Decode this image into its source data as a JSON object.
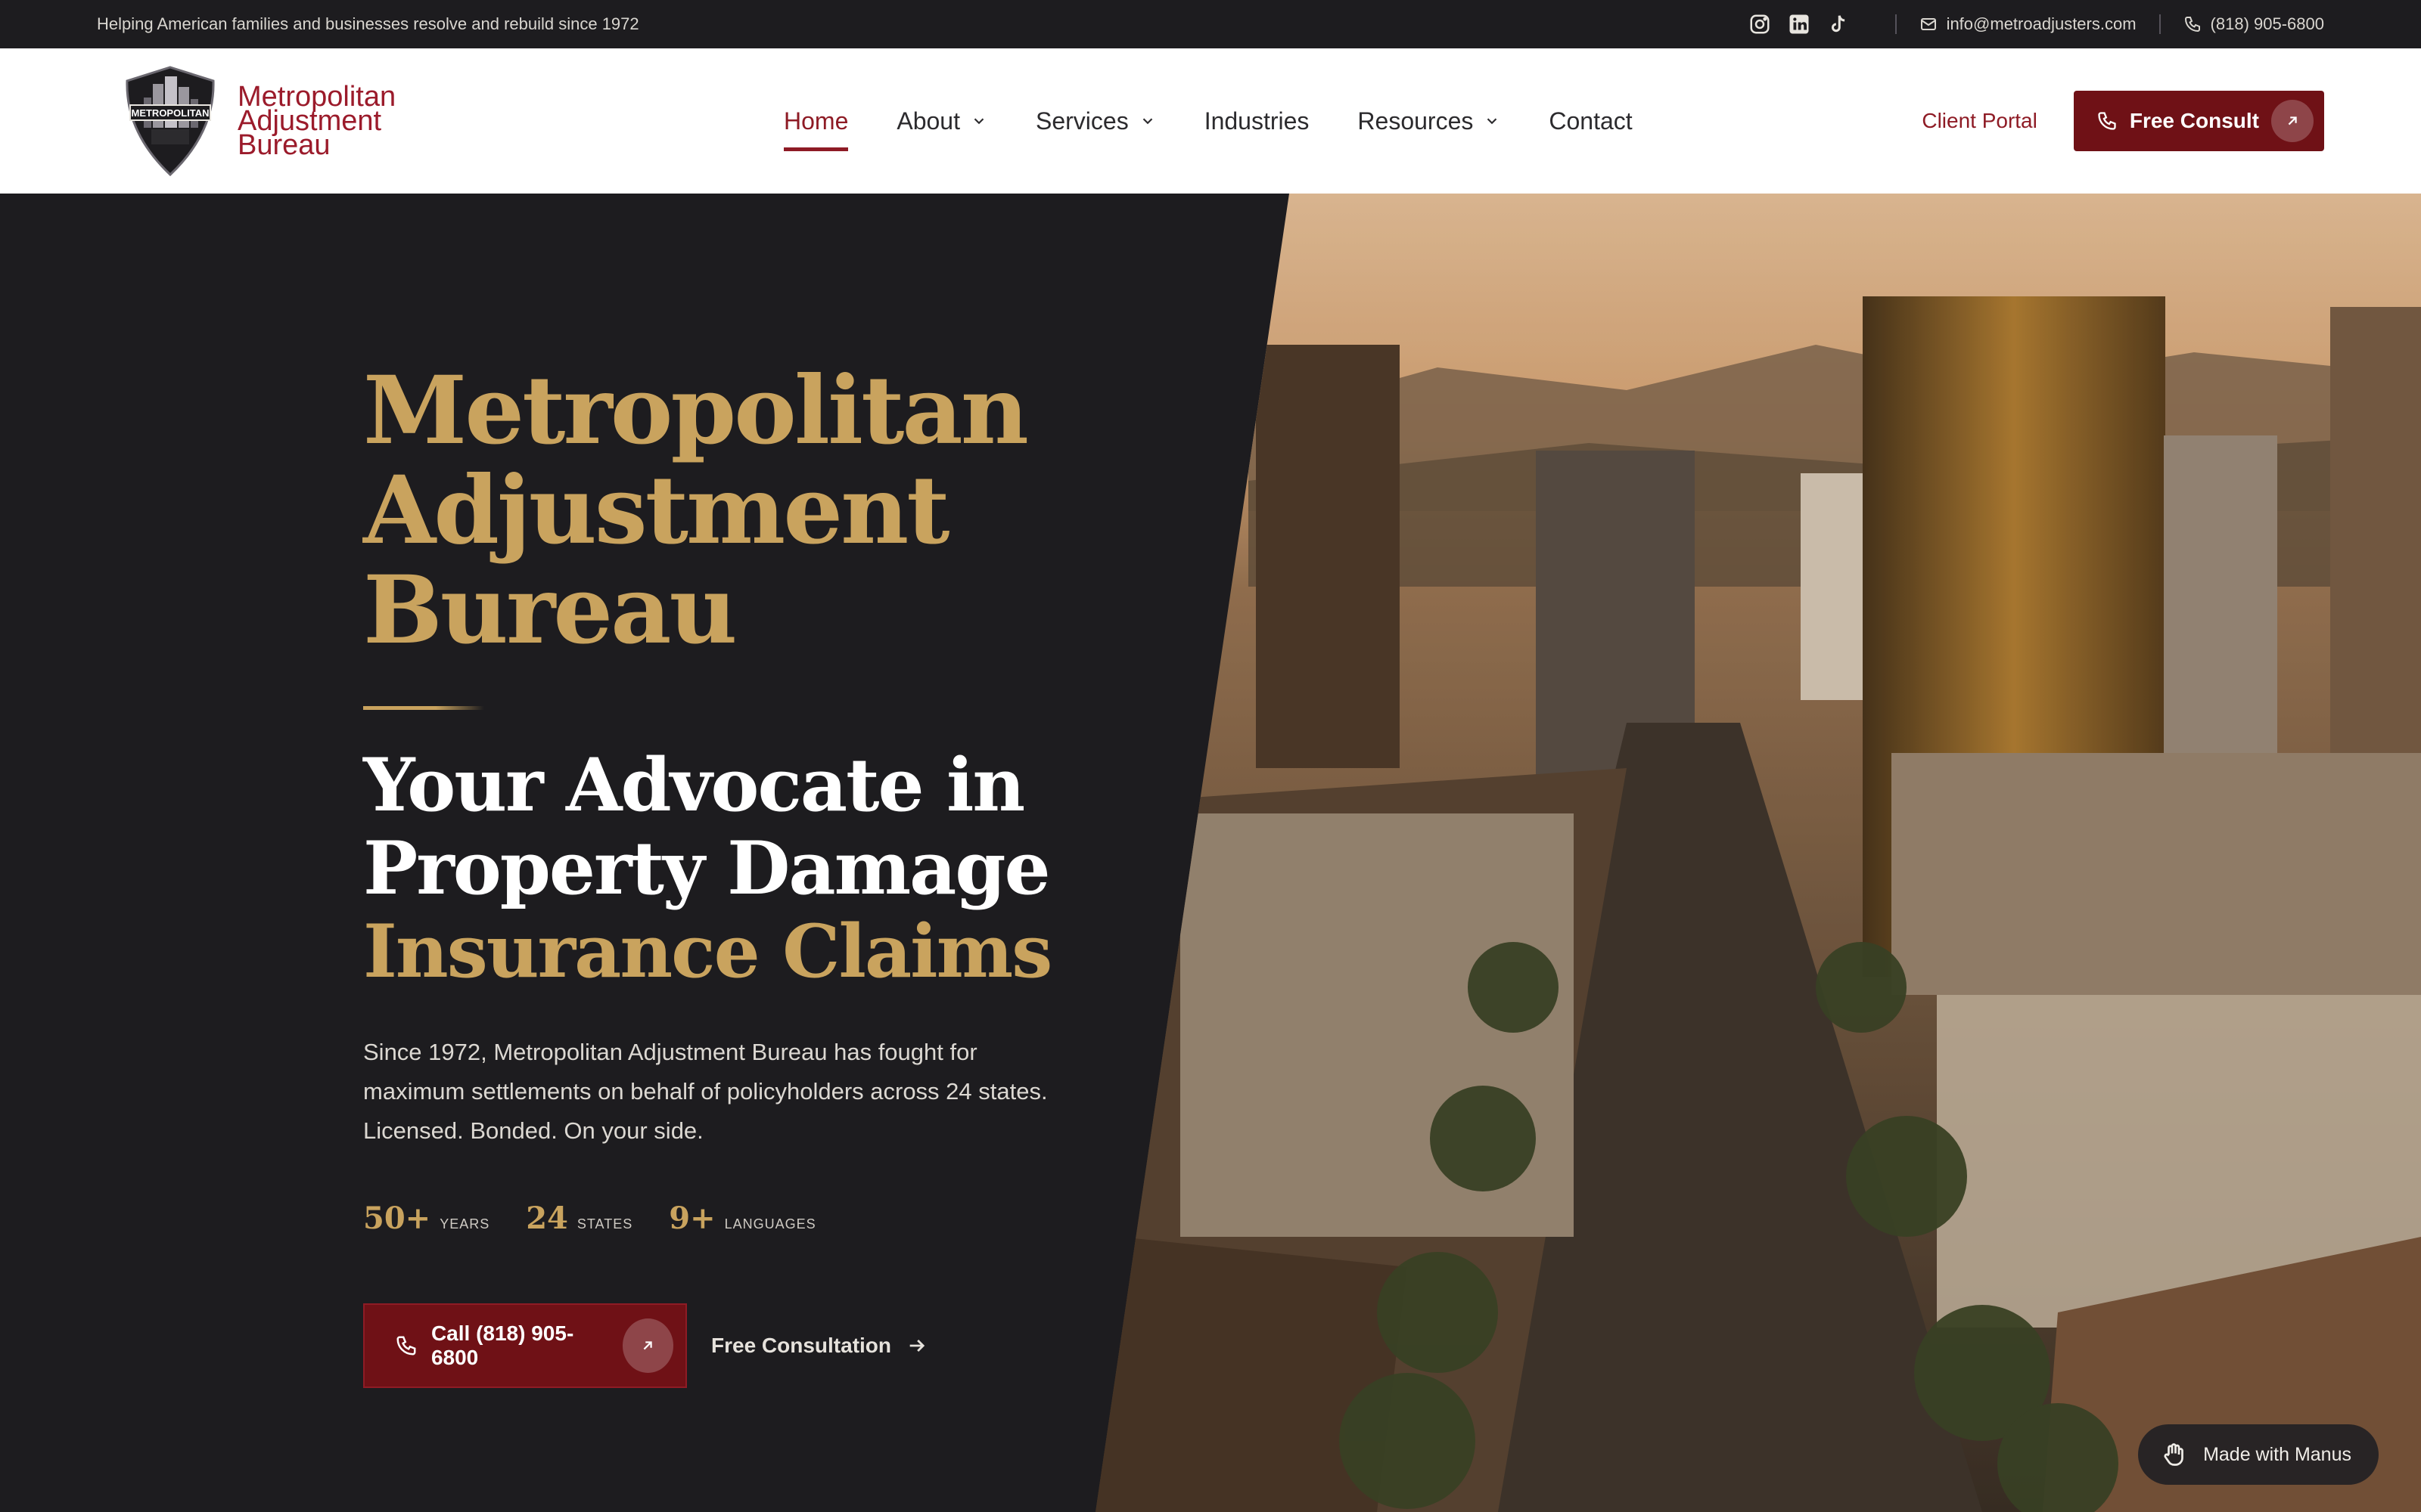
{
  "topbar": {
    "tagline": "Helping American families and businesses resolve and rebuild since 1972",
    "social": [
      "instagram-icon",
      "linkedin-icon",
      "tiktok-icon"
    ],
    "email": "info@metroadjusters.com",
    "phone": "(818) 905-6800"
  },
  "logo": {
    "badge_text": "METROPOLITAN",
    "line1": "Metropolitan",
    "line2": "Adjustment",
    "line3": "Bureau"
  },
  "nav": {
    "items": [
      {
        "label": "Home",
        "active": true,
        "dropdown": false
      },
      {
        "label": "About",
        "active": false,
        "dropdown": true
      },
      {
        "label": "Services",
        "active": false,
        "dropdown": true
      },
      {
        "label": "Industries",
        "active": false,
        "dropdown": false
      },
      {
        "label": "Resources",
        "active": false,
        "dropdown": true
      },
      {
        "label": "Contact",
        "active": false,
        "dropdown": false
      }
    ],
    "portal_label": "Client Portal",
    "consult_label": "Free Consult"
  },
  "hero": {
    "title_line1": "Metropolitan",
    "title_line2": "Adjustment",
    "title_line3": "Bureau",
    "sub_line1": "Your Advocate in",
    "sub_line2": "Property Damage",
    "sub_line3": "Insurance Claims",
    "body": "Since 1972, Metropolitan Adjustment Bureau has fought for maximum settlements on behalf of policyholders across 24 states. Licensed. Bonded. On your side.",
    "stats": [
      {
        "num": "50+",
        "label": "YEARS"
      },
      {
        "num": "24",
        "label": "STATES"
      },
      {
        "num": "9+",
        "label": "LANGUAGES"
      }
    ],
    "call_label": "Call (818) 905-6800",
    "free_label": "Free Consultation"
  },
  "badge": {
    "label": "Made with Manus"
  },
  "colors": {
    "brand_red": "#6f1116",
    "accent_gold": "#c9a35e",
    "dark_bg": "#1d1c1f"
  }
}
